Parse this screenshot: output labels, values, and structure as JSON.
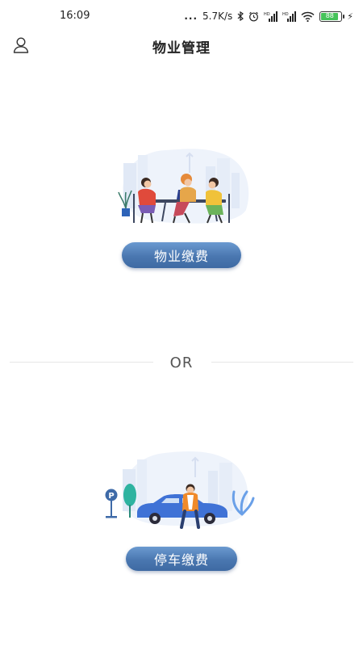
{
  "status_bar": {
    "time": "16:09",
    "dots": "...",
    "speed": "5.7K/s",
    "battery": "88",
    "icons": [
      "bluetooth-icon",
      "alarm-icon",
      "signal-hd-icon",
      "signal-hd-icon",
      "wifi-icon",
      "battery-icon",
      "charging-icon"
    ]
  },
  "header": {
    "title": "物业管理",
    "user_icon": "user-icon"
  },
  "property": {
    "button_label": "物业缴费"
  },
  "divider": {
    "label": "OR"
  },
  "parking": {
    "button_label": "停车缴费",
    "sign_letter": "P"
  },
  "colors": {
    "button_top": "#6b9ad0",
    "button_bottom": "#3e6aa3",
    "illustration_bg": "#eef3fb",
    "car": "#3f72d6"
  }
}
